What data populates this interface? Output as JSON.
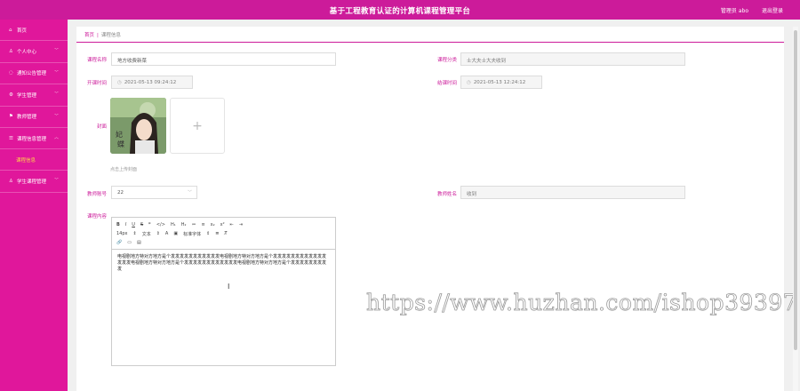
{
  "header": {
    "title": "基于工程教育认证的计算机课程管理平台",
    "user_label": "管理员 abo",
    "logout_label": "退出登录"
  },
  "sidebar": {
    "items": [
      {
        "label": "首页",
        "icon": "home-icon",
        "glyph": "⌂",
        "has_chevron": false
      },
      {
        "label": "个人中心",
        "icon": "user-icon",
        "glyph": "♙",
        "has_chevron": true
      },
      {
        "label": "通知公告管理",
        "icon": "power-icon",
        "glyph": "◌",
        "has_chevron": true
      },
      {
        "label": "学生管理",
        "icon": "settings-icon",
        "glyph": "⚙",
        "has_chevron": true
      },
      {
        "label": "教师管理",
        "icon": "flag-icon",
        "glyph": "⚑",
        "has_chevron": true
      },
      {
        "label": "课程信息管理",
        "icon": "list-icon",
        "glyph": "☰",
        "has_chevron": true
      },
      {
        "label": "学生课程管理",
        "icon": "user-icon",
        "glyph": "♙",
        "has_chevron": true
      }
    ],
    "sub_item": "课程信息"
  },
  "breadcrumb": {
    "home": "首页",
    "separator": "|",
    "current": "课程信息"
  },
  "form": {
    "course_name_label": "课程名称",
    "course_name_value": "地方收费新菜",
    "category_label": "课程分类",
    "category_value": "士大夫士大夫收到",
    "start_label": "开课时间",
    "start_value": "2021-05-13 09:24:12",
    "end_label": "结课时间",
    "end_value": "2021-05-13 12:24:12",
    "cover_label": "封面",
    "cover_hint": "点击上传封面",
    "upload_plus": "+",
    "teacher_id_label": "教师账号",
    "teacher_id_value": "22",
    "teacher_name_label": "教师姓名",
    "teacher_name_value": "收到",
    "content_label": "课程内容"
  },
  "editor": {
    "toolbar_row1": [
      "B",
      "I",
      "U",
      "S",
      "❞",
      "</>",
      "H₁",
      "H₂",
      "≔",
      "≡",
      "x₂",
      "x²",
      "⇤",
      "⇥"
    ],
    "toolbar_row2": [
      "14px",
      "⇕",
      "文本",
      "⇕",
      "A",
      "▣",
      "标准字体",
      "⇕",
      "≣",
      "T̸"
    ],
    "toolbar_row3": [
      "🔗",
      "▭",
      "▤"
    ],
    "text": "电视剧地方特对方地方是个发发发发发发发发发发发电视剧地方特对方地方是个发发发发发发发发发发发发发发发电视剧地方特对方地方是个发发发发发发发发发发发发电视剧地方特对方地方是个发发发发发发发发发"
  },
  "watermark": "https://www.huzhan.com/ishop39397",
  "colors": {
    "brand": "#cc1b9a",
    "sidebar": "#e0179b",
    "active_sub": "#ffd24a"
  }
}
